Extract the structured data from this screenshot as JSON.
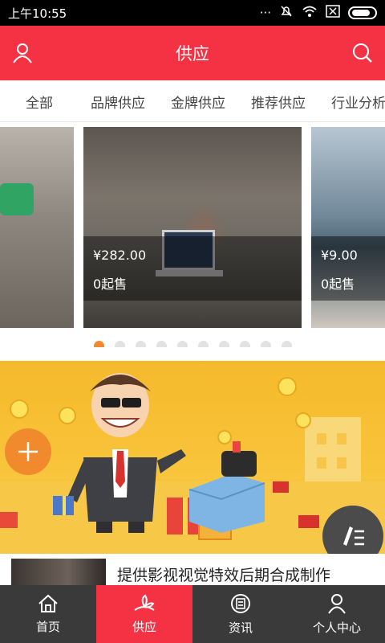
{
  "status_bar": {
    "time": "上午10:55"
  },
  "header": {
    "title": "供应",
    "left_icon": "user-icon",
    "right_icon": "search-icon"
  },
  "tabs": [
    {
      "label": "全部"
    },
    {
      "label": "品牌供应"
    },
    {
      "label": "金牌供应"
    },
    {
      "label": "推荐供应"
    },
    {
      "label": "行业分析"
    }
  ],
  "carousel": {
    "center": {
      "price": "¥282.00",
      "min_sale": "0起售"
    },
    "right": {
      "price": "¥9.00",
      "min_sale": "0起售"
    },
    "page_count": 10,
    "active_index": 0
  },
  "list": {
    "items": [
      {
        "title": "提供影视视觉特效后期合成制作"
      }
    ]
  },
  "bottom_nav": {
    "items": [
      {
        "label": "首页",
        "icon": "home-icon"
      },
      {
        "label": "供应",
        "icon": "supply-icon",
        "active": true
      },
      {
        "label": "资讯",
        "icon": "news-icon"
      },
      {
        "label": "个人中心",
        "icon": "profile-icon"
      }
    ]
  },
  "colors": {
    "primary": "#f43244",
    "accent": "#f08a2d",
    "nav_bg": "#3a3a3a",
    "banner": "#f6b92c"
  }
}
